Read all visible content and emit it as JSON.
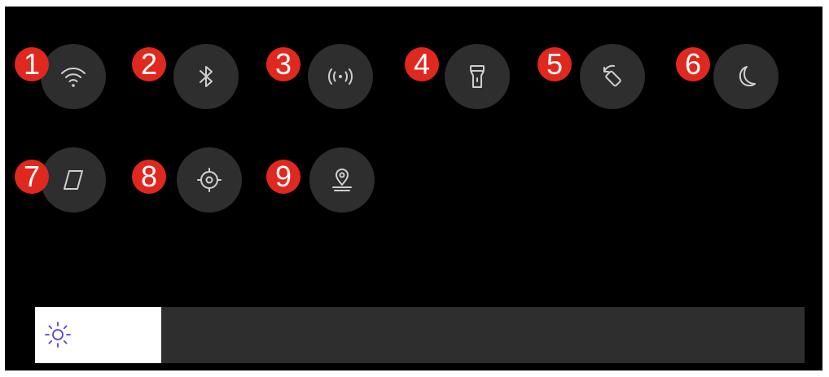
{
  "quick_settings": {
    "tiles": [
      {
        "id": "wifi",
        "badge": "1",
        "icon": "wifi-icon"
      },
      {
        "id": "bluetooth",
        "badge": "2",
        "icon": "bluetooth-icon"
      },
      {
        "id": "hotspot",
        "badge": "3",
        "icon": "hotspot-icon"
      },
      {
        "id": "flashlight",
        "badge": "4",
        "icon": "flashlight-icon"
      },
      {
        "id": "auto-rotate",
        "badge": "5",
        "icon": "rotate-icon"
      },
      {
        "id": "dark-mode",
        "badge": "6",
        "icon": "moon-icon"
      },
      {
        "id": "compass",
        "badge": "7",
        "icon": "compass-icon"
      },
      {
        "id": "location",
        "badge": "8",
        "icon": "crosshair-icon"
      },
      {
        "id": "location-pin",
        "badge": "9",
        "icon": "map-pin-icon"
      }
    ]
  },
  "brightness": {
    "level_fraction": 0.164,
    "icon": "sun-icon"
  },
  "colors": {
    "background": "#000000",
    "tile": "#2e2e2e",
    "badge": "#e0281f",
    "icon_stroke": "#cfcfcf",
    "brightness_icon": "#5b3fd6"
  }
}
